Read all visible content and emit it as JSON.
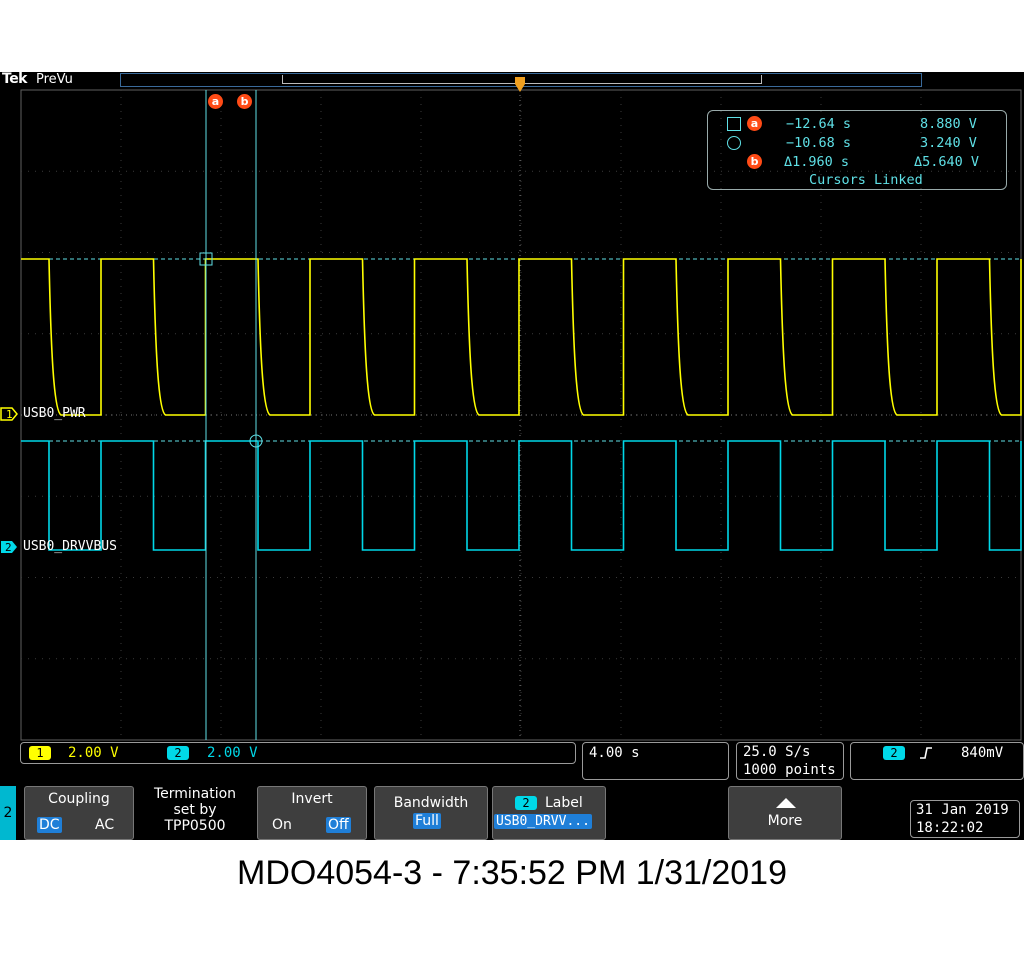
{
  "topbar": {
    "brand": "Tek",
    "mode": "PreVu"
  },
  "cursors": {
    "a_label": "a",
    "b_label": "b"
  },
  "readout": {
    "a_time": "−12.64 s",
    "a_volt": "8.880 V",
    "b_time": "−10.68 s",
    "b_volt": "3.240 V",
    "delta_time": "Δ1.960 s",
    "delta_volt": "Δ5.640 V",
    "linked": "Cursors Linked"
  },
  "channels": [
    {
      "number": "1",
      "name": "USB0_PWR",
      "color": "#ffff00",
      "scale": "2.00 V"
    },
    {
      "number": "2",
      "name": "USB0_DRVVBUS",
      "color": "#00d8e8",
      "scale": "2.00 V"
    }
  ],
  "status": {
    "timebase": "4.00 s",
    "sample_rate": "25.0 S/s",
    "record_length": "1000 points",
    "trigger_channel": "2",
    "trigger_level": "840mV",
    "date": "31 Jan  2019",
    "time": "18:22:02"
  },
  "menu": {
    "channel_tab": "2",
    "coupling": {
      "title": "Coupling",
      "opt1": "DC",
      "opt2": "AC"
    },
    "termination": {
      "line1": "Termination",
      "line2": "set by",
      "line3": "TPP0500"
    },
    "invert": {
      "title": "Invert",
      "opt1": "On",
      "opt2": "Off"
    },
    "bandwidth": {
      "title": "Bandwidth",
      "value": "Full"
    },
    "label": {
      "channel": "2",
      "title": "Label",
      "value": "USB0_DRVV..."
    },
    "more": {
      "title": "More"
    }
  },
  "caption": "MDO4054-3 - 7:35:52 PM    1/31/2019",
  "colors": {
    "ch1": "#ffff00",
    "ch2": "#00d8e8",
    "cursor": "#5fe0e6",
    "accent": "#ff4b16",
    "selected": "#1f7fd8"
  }
}
